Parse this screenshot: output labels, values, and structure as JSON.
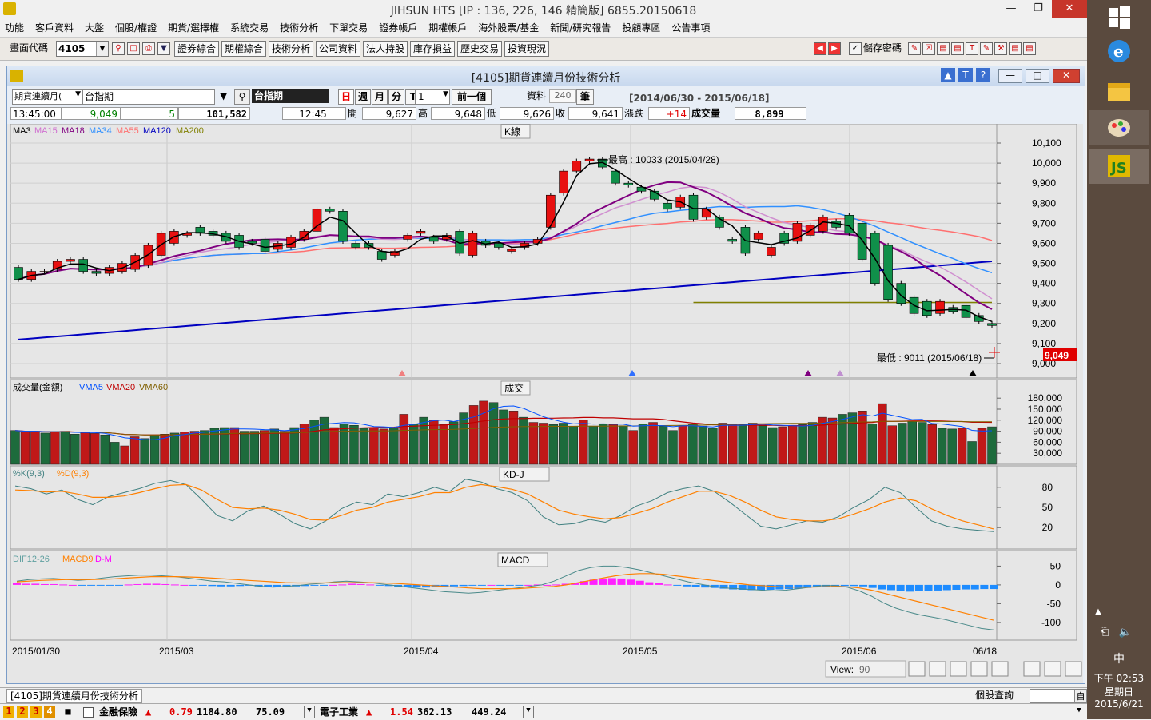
{
  "app": {
    "title": "JIHSUN HTS     [IP : 136, 226, 146 精簡版] 6855.20150618",
    "min_icon": "minimize-icon",
    "restore_icon": "restore-icon",
    "close_icon": "close-icon"
  },
  "menu": [
    "功能",
    "客戶資料",
    "大盤",
    "個股/權證",
    "期貨/選擇權",
    "系統交易",
    "技術分析",
    "下單交易",
    "證券帳戶",
    "期權帳戶",
    "海外股票/基金",
    "新聞/研究報告",
    "投顧專區",
    "公告事項"
  ],
  "toolbar": {
    "code_label": "畫面代碼",
    "code_value": "4105",
    "buttons": [
      "證券綜合",
      "期權綜合",
      "技術分析",
      "公司資料",
      "法人持股",
      "庫存損益",
      "歷史交易",
      "投資現況"
    ],
    "save_password_label": "儲存密碼",
    "save_password_checked": true
  },
  "child": {
    "title": "[4105]期貨連續月份技術分析",
    "period_select": "期貨連續月(",
    "symbol_value": "台指期",
    "symbol_display": "台指期",
    "period_buttons": [
      "日",
      "週",
      "月",
      "分",
      "T"
    ],
    "interval_value": "1",
    "prev_button": "前一個",
    "data_label": "資料",
    "data_count": "240",
    "data_unit": "筆",
    "date_range": "[2014/06/30 - 2015/06/18]"
  },
  "quote": {
    "time": "13:45:00",
    "price": "9,049",
    "change": "5",
    "volume": "101,582",
    "bar_time": "12:45",
    "open_label": "開",
    "open": "9,627",
    "high_label": "高",
    "high": "9,648",
    "low_label": "低",
    "low": "9,626",
    "close_label": "收",
    "close": "9,641",
    "chg_label": "漲跌",
    "chg": "+14",
    "vol_label": "成交量",
    "vol": "8,899"
  },
  "panels": {
    "kline_title": "K線",
    "vol_title": "成交",
    "kd_title": "KD-J",
    "macd_title": "MACD",
    "kline_legend": [
      {
        "name": "MA3",
        "color": "#000000"
      },
      {
        "name": "MA15",
        "color": "#d070d0"
      },
      {
        "name": "MA18",
        "color": "#800080"
      },
      {
        "name": "MA34",
        "color": "#3090ff"
      },
      {
        "name": "MA55",
        "color": "#ff7070"
      },
      {
        "name": "MA120",
        "color": "#0000c0"
      },
      {
        "name": "MA200",
        "color": "#808000"
      }
    ],
    "vol_legend": [
      {
        "name": "成交量(金額)",
        "color": "#000000"
      },
      {
        "name": "VMA5",
        "color": "#0050ff"
      },
      {
        "name": "VMA20",
        "color": "#c00000"
      },
      {
        "name": "VMA60",
        "color": "#806000"
      }
    ],
    "kd_legend": [
      {
        "name": "%K(9,3)",
        "color": "#408080"
      },
      {
        "name": "%D(9,3)",
        "color": "#ff8000"
      }
    ],
    "macd_legend": [
      {
        "name": "DIF12-26",
        "color": "#60a0a0"
      },
      {
        "name": "MACD9",
        "color": "#ff8000"
      },
      {
        "name": "D-M",
        "color": "#ff00ff"
      }
    ],
    "high_annotation": "最高 : 10033 (2015/04/28)",
    "low_annotation": "最低 : 9011 (2015/06/18)",
    "last_price_tag": "9,049",
    "price_axis": [
      "10,100",
      "10,000",
      "9,900",
      "9,800",
      "9,700",
      "9,600",
      "9,500",
      "9,400",
      "9,300",
      "9,200",
      "9,100",
      "9,000"
    ],
    "vol_axis": [
      "180,000",
      "150,000",
      "120,000",
      "90,000",
      "60,000",
      "30,000"
    ],
    "kd_axis": [
      "80",
      "50",
      "20"
    ],
    "macd_axis": [
      "50",
      "0",
      "-50",
      "-100"
    ],
    "date_axis": [
      "2015/01/30",
      "2015/03",
      "2015/04",
      "2015/05",
      "2015/06",
      "06/18"
    ],
    "view_label": "View:",
    "view_value": "90"
  },
  "chart_data": {
    "type": "candlestick",
    "price_ylim": [
      9000,
      10100
    ],
    "open": [
      9480,
      9420,
      9460,
      9470,
      9510,
      9520,
      9460,
      9450,
      9460,
      9470,
      9490,
      9540,
      9600,
      9640,
      9680,
      9660,
      9650,
      9640,
      9610,
      9620,
      9570,
      9580,
      9620,
      9660,
      9770,
      9760,
      9600,
      9600,
      9560,
      9540,
      9620,
      9650,
      9630,
      9620,
      9660,
      9540,
      9610,
      9600,
      9560,
      9580,
      9600,
      9680,
      9850,
      9960,
      10010,
      10020,
      9960,
      9900,
      9880,
      9860,
      9800,
      9780,
      9840,
      9730,
      9730,
      9620,
      9680,
      9620,
      9540,
      9650,
      9610,
      9640,
      9660,
      9710,
      9740,
      9700,
      9650,
      9590,
      9400,
      9330,
      9310,
      9250,
      9280,
      9290,
      9240,
      9200
    ],
    "close": [
      9420,
      9460,
      9460,
      9510,
      9520,
      9460,
      9450,
      9480,
      9500,
      9540,
      9590,
      9650,
      9660,
      9650,
      9650,
      9640,
      9610,
      9580,
      9600,
      9560,
      9600,
      9630,
      9660,
      9770,
      9760,
      9610,
      9580,
      9580,
      9520,
      9560,
      9640,
      9660,
      9610,
      9640,
      9550,
      9650,
      9590,
      9580,
      9570,
      9600,
      9620,
      9840,
      9960,
      10010,
      10020,
      9980,
      9900,
      9890,
      9860,
      9820,
      9770,
      9830,
      9720,
      9770,
      9680,
      9610,
      9550,
      9650,
      9580,
      9600,
      9700,
      9690,
      9730,
      9680,
      9650,
      9520,
      9400,
      9320,
      9300,
      9250,
      9240,
      9310,
      9260,
      9230,
      9210,
      9190
    ],
    "ma3_label": "MA3",
    "ma15_label": "MA15",
    "ma18_label": "MA18",
    "ma34_label": "MA34",
    "ma55_label": "MA55",
    "ma120_label": "MA120",
    "ma200_label": "MA200",
    "volume": [
      92000,
      88000,
      90000,
      85000,
      88000,
      90000,
      82000,
      86000,
      84000,
      80000,
      60000,
      50000,
      75000,
      70000,
      80000,
      82000,
      85000,
      88000,
      90000,
      92000,
      98000,
      100000,
      100000,
      90000,
      90000,
      92000,
      96000,
      90000,
      100000,
      110000,
      120000,
      128000,
      100000,
      110000,
      106000,
      98000,
      100000,
      96000,
      100000,
      136000,
      110000,
      128000,
      120000,
      108000,
      116000,
      140000,
      160000,
      172000,
      168000,
      148000,
      145000,
      128000,
      114000,
      112000,
      108000,
      112000,
      104000,
      120000,
      104000,
      110000,
      108000,
      105000,
      92000,
      110000,
      114000,
      104000,
      92000,
      105000,
      110000,
      104000,
      98000,
      112000,
      108000,
      110000,
      112000,
      105000,
      100000,
      102000,
      106000,
      108000,
      114000,
      128000,
      126000,
      136000,
      140000,
      145000,
      110000,
      165000,
      105000,
      112000,
      116000,
      114000,
      108000,
      98000,
      96000,
      98000,
      62000,
      98000,
      102000
    ],
    "kd_ylim": [
      0,
      100
    ],
    "macd_ylim": [
      -130,
      70
    ]
  }
}
